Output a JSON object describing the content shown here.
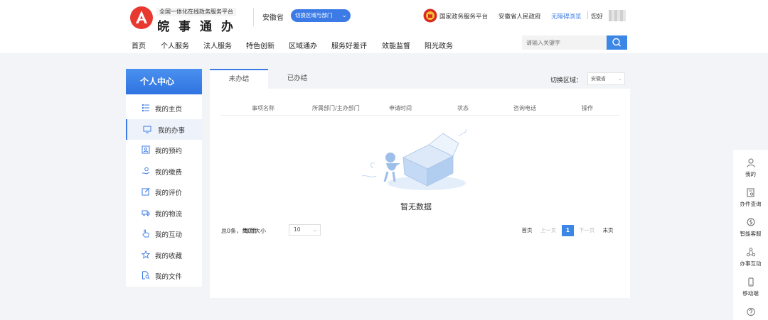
{
  "header": {
    "logo_subtitle": "全国一体化在线政务服务平台",
    "logo_title": "皖事通办",
    "region": "安徽省",
    "region_switch_label": "切换区域与部门",
    "links": {
      "national": "国家政务服务平台",
      "province": "安徽省人民政府",
      "accessibility": "无障碍浏览",
      "greeting": "您好"
    },
    "nav": [
      "首页",
      "个人服务",
      "法人服务",
      "特色创新",
      "区域通办",
      "服务好差评",
      "效能监督",
      "阳光政务"
    ],
    "search_placeholder": "请输入关键字"
  },
  "sidebar": {
    "title": "个人中心",
    "items": [
      {
        "label": "我的主页",
        "icon": "list-icon"
      },
      {
        "label": "我的办事",
        "icon": "monitor-icon",
        "active": true
      },
      {
        "label": "我的预约",
        "icon": "contact-card-icon"
      },
      {
        "label": "我的缴费",
        "icon": "payment-hand-icon"
      },
      {
        "label": "我的评价",
        "icon": "edit-icon"
      },
      {
        "label": "我的物流",
        "icon": "truck-icon"
      },
      {
        "label": "我的互动",
        "icon": "pointer-hand-icon"
      },
      {
        "label": "我的收藏",
        "icon": "star-icon"
      },
      {
        "label": "我的文件",
        "icon": "file-search-icon"
      }
    ]
  },
  "main": {
    "tabs": [
      {
        "label": "未办结",
        "active": true
      },
      {
        "label": "已办结",
        "active": false
      }
    ],
    "switch_area_label": "切换区域：",
    "switch_area_value": "安徽省",
    "columns": [
      "事项名称",
      "所属部门/主办部门",
      "申请时间",
      "状态",
      "咨询电话",
      "操作"
    ],
    "empty_text": "暂无数据",
    "pagination": {
      "info": "总0条，共0页",
      "page_size_label": "每页大小",
      "page_size": "10",
      "first": "首页",
      "prev": "上一页",
      "current": "1",
      "next": "下一页",
      "last": "末页"
    }
  },
  "dock": [
    {
      "label": "我的",
      "icon": "user-icon"
    },
    {
      "label": "办件查询",
      "icon": "document-search-icon"
    },
    {
      "label": "智能客服",
      "icon": "chat-icon"
    },
    {
      "label": "办事互动",
      "icon": "share-icon"
    },
    {
      "label": "移动端",
      "icon": "mobile-icon"
    },
    {
      "label": "",
      "icon": "help-icon"
    }
  ],
  "colors": {
    "accent": "#3c7be6",
    "page_bg": "#f3f4f7"
  }
}
